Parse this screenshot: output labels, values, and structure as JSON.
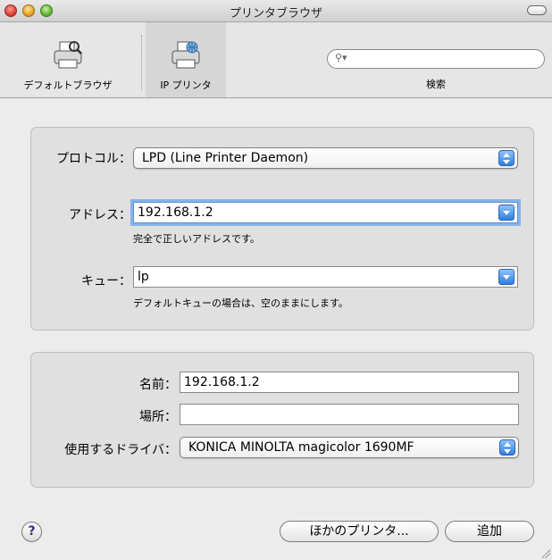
{
  "window": {
    "title": "プリンタブラウザ"
  },
  "toolbar": {
    "items": [
      {
        "label": "デフォルトブラウザ",
        "icon": "printer-default-icon"
      },
      {
        "label": "IP プリンタ",
        "icon": "printer-ip-icon",
        "selected": true
      }
    ],
    "search": {
      "placeholder": "",
      "label": "検索"
    }
  },
  "connection": {
    "protocol_label": "プロトコル：",
    "protocol_value": "LPD (Line Printer Daemon)",
    "address_label": "アドレス：",
    "address_value": "192.168.1.2",
    "address_hint": "完全で正しいアドレスです。",
    "queue_label": "キュー：",
    "queue_value": "lp",
    "queue_hint": "デフォルトキューの場合は、空のままにします。"
  },
  "printer": {
    "name_label": "名前：",
    "name_value": "192.168.1.2",
    "location_label": "場所：",
    "location_value": "",
    "driver_label": "使用するドライバ：",
    "driver_value": "KONICA MINOLTA magicolor 1690MF"
  },
  "buttons": {
    "help": "?",
    "other_printers": "ほかのプリンタ...",
    "add": "追加"
  },
  "colors": {
    "accent_blue": "#2f7fe0",
    "focus_ring": "#86b3e8",
    "window_bg": "#ececec"
  }
}
